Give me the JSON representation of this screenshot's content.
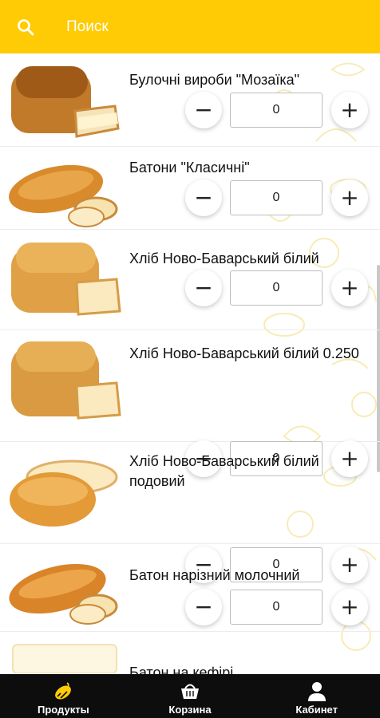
{
  "header": {
    "search_label": "Поиск",
    "color": "#ffcb05"
  },
  "products": [
    {
      "name": "Булочні вироби \"Мозаїка\"",
      "qty": "0"
    },
    {
      "name": "Батони \"Класичні\"",
      "qty": "0"
    },
    {
      "name": "Хліб Ново-Баварський білий",
      "qty": "0"
    },
    {
      "name": "Хліб Ново-Баварський білий 0.250",
      "qty": "0"
    },
    {
      "name": "Хліб Ново-Баварський білий подовий",
      "qty": "0"
    },
    {
      "name": "Батон нарізний молочний",
      "qty": "0"
    },
    {
      "name": "Батон на кефірі"
    }
  ],
  "buttons": {
    "minus": "−",
    "plus": "+"
  },
  "tabbar": {
    "tabs": [
      {
        "label": "Продукты",
        "icon": "bread-icon"
      },
      {
        "label": "Корзина",
        "icon": "basket-icon"
      },
      {
        "label": "Кабинет",
        "icon": "user-icon"
      }
    ],
    "active_color": "#ffcb05"
  }
}
